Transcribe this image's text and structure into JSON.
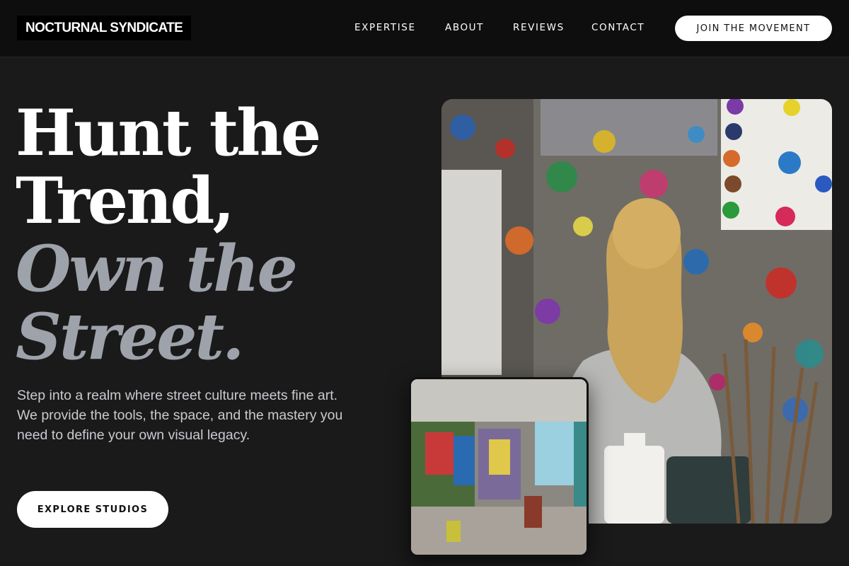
{
  "brand": {
    "logo_text": "NOCTURNAL SYNDICATE"
  },
  "nav": {
    "links": [
      "EXPERTISE",
      "ABOUT",
      "REVIEWS",
      "CONTACT"
    ],
    "cta_label": "JOIN THE MOVEMENT"
  },
  "hero": {
    "headline_line1": "Hunt the",
    "headline_line2": "Trend,",
    "headline_line3": "Own the",
    "headline_line4": "Street.",
    "intro": "Step into a realm where street culture meets fine art. We provide the tools, the space, and the mastery you need to define your own visual legacy.",
    "cta_label": "EXPLORE STUDIOS"
  },
  "images": {
    "main": "child-at-paint-splattered-wall-photo",
    "inset": "graffiti-studio-interior-photo"
  },
  "colors": {
    "background": "#1a1a1a",
    "navbar": "#0e0e0e",
    "accent_text": "#9ea2ab",
    "button_bg": "#ffffff"
  }
}
